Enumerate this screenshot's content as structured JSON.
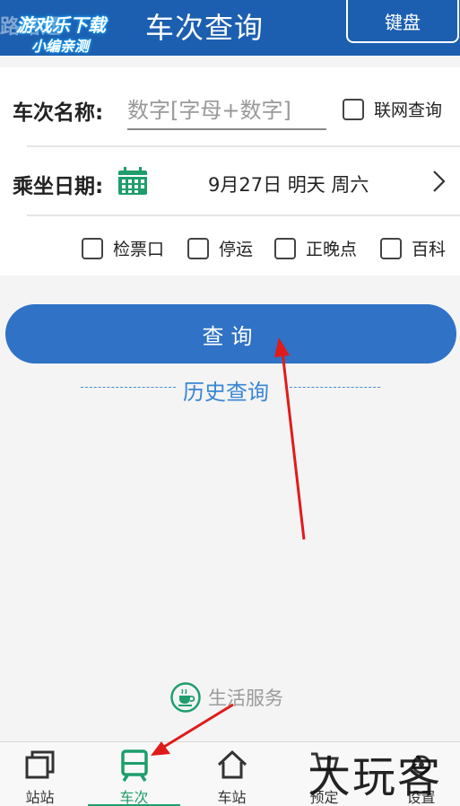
{
  "header": {
    "brand_text": "路路通",
    "title": "车次查询",
    "keyboard_button": "键盘"
  },
  "watermark": {
    "line1": "游戏乐下载",
    "line2": "小编亲测",
    "bottom": "大玩客"
  },
  "form": {
    "train_label": "车次名称:",
    "train_placeholder": "数字[字母+数字]",
    "train_value": "",
    "online_label": "联网查询",
    "online_checked": false,
    "date_label": "乘坐日期:",
    "date_value": "9月27日 明天 周六",
    "options": [
      {
        "label": "检票口",
        "checked": false
      },
      {
        "label": "停运",
        "checked": false
      },
      {
        "label": "正晚点",
        "checked": false
      },
      {
        "label": "百科",
        "checked": false
      }
    ]
  },
  "actions": {
    "query_button": "查询",
    "history_link": "历史查询"
  },
  "life_service": {
    "label": "生活服务",
    "icon": "coffee-cup-icon"
  },
  "bottom_nav": {
    "active_index": 1,
    "active_color": "#1e9e6d",
    "items": [
      {
        "label": "站站",
        "icon": "station-to-station-icon"
      },
      {
        "label": "车次",
        "icon": "train-icon"
      },
      {
        "label": "车站",
        "icon": "home-station-icon"
      },
      {
        "label": "预定",
        "icon": "cart-icon"
      },
      {
        "label": "设置",
        "icon": "settings-icon"
      }
    ]
  },
  "colors": {
    "header_bg": "#1c5fb0",
    "query_button_bg": "#2f72c6",
    "history_link": "#3a86d2",
    "accent_green": "#1e9e6d",
    "annotation_arrow": "#e01b1b"
  }
}
